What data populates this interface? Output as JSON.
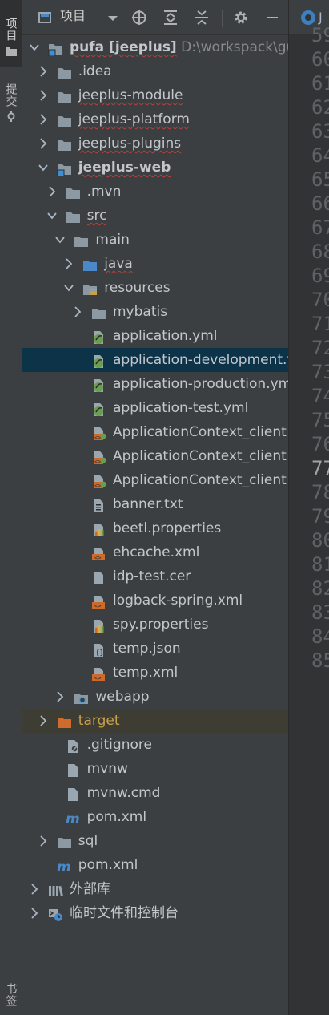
{
  "left_strip": {
    "project_tab": "项目",
    "commit_tab": "提交",
    "bookmarks_tab": "书签"
  },
  "toolbar": {
    "view_label": "项目"
  },
  "tree": [
    {
      "label": "pufa [jeeplus]",
      "path": "D:\\workspack\\gu",
      "bold": true,
      "wavy": true
    },
    {
      "label": ".idea"
    },
    {
      "label": "jeeplus-module",
      "wavy": true
    },
    {
      "label": "jeeplus-platform",
      "wavy": true
    },
    {
      "label": "jeeplus-plugins",
      "wavy": true
    },
    {
      "label": "jeeplus-web",
      "bold": true,
      "wavy": true
    },
    {
      "label": ".mvn"
    },
    {
      "label": "src",
      "wavy": true
    },
    {
      "label": "main"
    },
    {
      "label": "java",
      "wavy": true
    },
    {
      "label": "resources"
    },
    {
      "label": "mybatis"
    },
    {
      "label": "application.yml"
    },
    {
      "label": "application-development.yml",
      "selected": true
    },
    {
      "label": "application-production.yml"
    },
    {
      "label": "application-test.yml"
    },
    {
      "label": "ApplicationContext_client"
    },
    {
      "label": "ApplicationContext_client"
    },
    {
      "label": "ApplicationContext_client"
    },
    {
      "label": "banner.txt"
    },
    {
      "label": "beetl.properties"
    },
    {
      "label": "ehcache.xml"
    },
    {
      "label": "idp-test.cer"
    },
    {
      "label": "logback-spring.xml"
    },
    {
      "label": "spy.properties"
    },
    {
      "label": "temp.json"
    },
    {
      "label": "temp.xml"
    },
    {
      "label": "webapp"
    },
    {
      "label": "target",
      "excluded": true
    },
    {
      "label": ".gitignore"
    },
    {
      "label": "mvnw"
    },
    {
      "label": "mvnw.cmd"
    },
    {
      "label": "pom.xml"
    },
    {
      "label": "sql"
    },
    {
      "label": "pom.xml"
    },
    {
      "label": "外部库"
    },
    {
      "label": "临时文件和控制台"
    }
  ],
  "editor": {
    "tab_label": "J",
    "line_numbers": [
      "59",
      "60",
      "61",
      "62",
      "63",
      "64",
      "65",
      "66",
      "67",
      "68",
      "69",
      "70",
      "71",
      "72",
      "73",
      "74",
      "75",
      "76",
      "77",
      "78",
      "79",
      "80",
      "81",
      "82",
      "83",
      "84",
      "85"
    ],
    "current_line": "77"
  },
  "colors": {
    "selection": "#0d3349",
    "excluded_bg": "#3e3d33",
    "excluded_text": "#c9a04b",
    "folder": "#8c99a3",
    "source_folder": "#4a88c7",
    "spring": "#6a9e4f",
    "xml": "#cc6a2c"
  }
}
